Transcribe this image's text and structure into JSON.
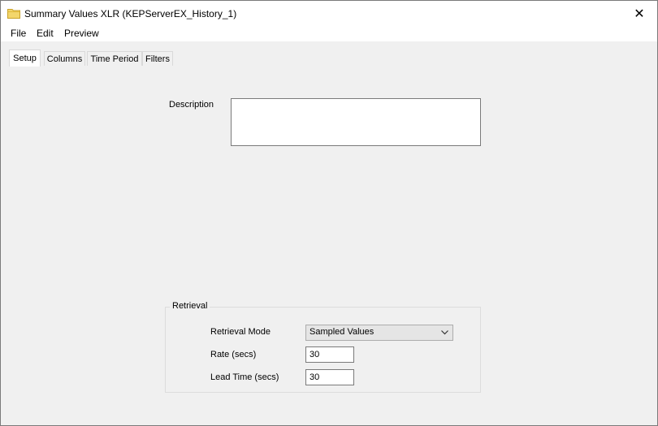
{
  "window": {
    "title": "Summary Values XLR (KEPServerEX_History_1)",
    "icon": "folder-icon",
    "close_glyph": "✕"
  },
  "menu": {
    "items": [
      "File",
      "Edit",
      "Preview"
    ]
  },
  "tabs": [
    {
      "label": "Setup",
      "active": true
    },
    {
      "label": "Columns",
      "active": false
    },
    {
      "label": "Time Period",
      "active": false
    },
    {
      "label": "Filters",
      "active": false
    }
  ],
  "setup": {
    "description_label": "Description",
    "description_value": "",
    "retrieval": {
      "title": "Retrieval",
      "mode_label": "Retrieval Mode",
      "mode_value": "Sampled Values",
      "rate_label": "Rate (secs)",
      "rate_value": "30",
      "lead_label": "Lead Time (secs)",
      "lead_value": "30"
    }
  }
}
